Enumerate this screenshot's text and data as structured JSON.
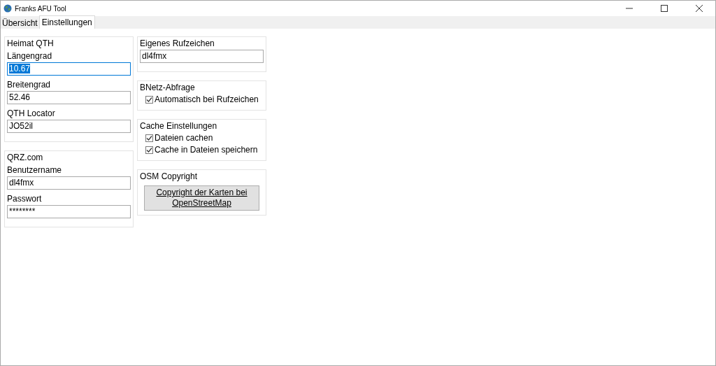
{
  "window": {
    "title": "Franks AFU Tool"
  },
  "tabs": [
    {
      "label": "Übersicht",
      "selected": false
    },
    {
      "label": "Einstellungen",
      "selected": true
    }
  ],
  "columns": [
    [
      {
        "title": "Heimat QTH",
        "items": [
          {
            "kind": "label",
            "text": "Längengrad"
          },
          {
            "kind": "field",
            "value": "10.67",
            "focused": true
          },
          {
            "kind": "label",
            "text": "Breitengrad"
          },
          {
            "kind": "field",
            "value": "52.46",
            "focused": false
          },
          {
            "kind": "label",
            "text": "QTH Locator"
          },
          {
            "kind": "field",
            "value": "JO52il",
            "focused": false
          }
        ]
      },
      {
        "title": "QRZ.com",
        "items": [
          {
            "kind": "label",
            "text": "Benutzername"
          },
          {
            "kind": "field",
            "value": "dl4fmx",
            "focused": false
          },
          {
            "kind": "label",
            "text": "Passwort"
          },
          {
            "kind": "field",
            "value": "********",
            "focused": false
          }
        ]
      }
    ],
    [
      {
        "title": "Eigenes Rufzeichen",
        "items": [
          {
            "kind": "field",
            "value": "dl4fmx",
            "focused": false
          }
        ]
      },
      {
        "title": "BNetz-Abfrage",
        "items": [
          {
            "kind": "checkbox",
            "text": "Automatisch bei Rufzeichen",
            "checked": true
          }
        ]
      },
      {
        "title": "Cache Einstellungen",
        "items": [
          {
            "kind": "checkbox",
            "text": "Dateien cachen",
            "checked": true
          },
          {
            "kind": "checkbox",
            "text": "Cache in Dateien speichern",
            "checked": true
          }
        ]
      },
      {
        "title": "OSM Copyright",
        "items": [
          {
            "kind": "button",
            "text": "Copyright der Karten bei OpenStreetMap"
          }
        ]
      }
    ]
  ]
}
